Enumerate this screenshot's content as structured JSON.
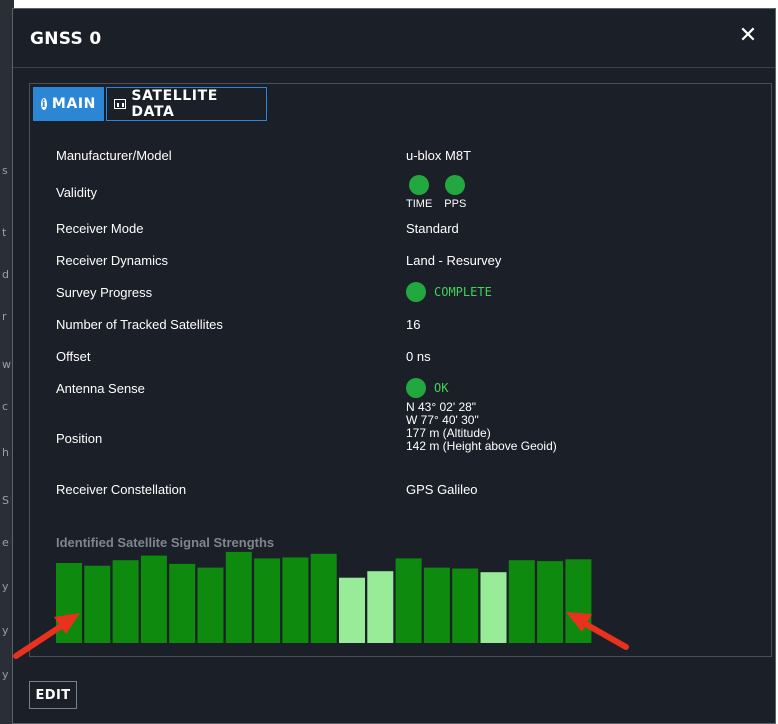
{
  "dialog": {
    "title": "GNSS 0",
    "close_symbol": "✕",
    "tabs": [
      {
        "label": "MAIN",
        "icon": "info-icon",
        "active": true
      },
      {
        "label": "SATELLITE DATA",
        "icon": "chart-icon",
        "active": false
      }
    ],
    "edit_label": "EDIT"
  },
  "rows": {
    "manufacturer": {
      "label": "Manufacturer/Model",
      "value": "u-blox M8T"
    },
    "validity": {
      "label": "Validity",
      "items": [
        "TIME",
        "PPS"
      ]
    },
    "receiver_mode": {
      "label": "Receiver Mode",
      "value": "Standard"
    },
    "receiver_dynamics": {
      "label": "Receiver Dynamics",
      "value": "Land - Resurvey"
    },
    "survey_progress": {
      "label": "Survey Progress",
      "value": "COMPLETE"
    },
    "tracked_satellites": {
      "label": "Number of Tracked Satellites",
      "value": "16"
    },
    "offset": {
      "label": "Offset",
      "value": "0 ns"
    },
    "antenna_sense": {
      "label": "Antenna Sense",
      "value": "OK"
    },
    "position": {
      "label": "Position",
      "lines": [
        "N 43° 02' 28\"",
        "W 77° 40' 30\"",
        "177 m (Altitude)",
        "142 m (Height above Geoid)"
      ]
    },
    "constellation": {
      "label": "Receiver Constellation",
      "value": "GPS Galileo"
    }
  },
  "backdrop_letters": [
    "s",
    "t",
    "d",
    "r",
    "w",
    "c",
    "h",
    "S",
    "e",
    "y",
    "y",
    "y"
  ],
  "colors": {
    "bar_strong": "#0e8a0e",
    "bar_weak": "#98ec98",
    "status_green": "#22a83e",
    "accent_blue": "#2b87d6",
    "arrow_red": "#e8321e"
  },
  "chart_data": {
    "type": "bar",
    "title": "Identified Satellite Signal Strengths",
    "xlabel": "",
    "ylabel": "",
    "ylim": [
      0,
      100
    ],
    "grid": false,
    "legend": "none",
    "values": [
      87,
      84,
      90,
      95,
      86,
      82,
      99,
      92,
      93,
      97,
      71,
      78,
      92,
      82,
      81,
      77,
      90,
      89,
      91
    ],
    "strength": [
      "strong",
      "strong",
      "strong",
      "strong",
      "strong",
      "strong",
      "strong",
      "strong",
      "strong",
      "strong",
      "weak",
      "weak",
      "strong",
      "strong",
      "strong",
      "weak",
      "strong",
      "strong",
      "strong"
    ]
  }
}
